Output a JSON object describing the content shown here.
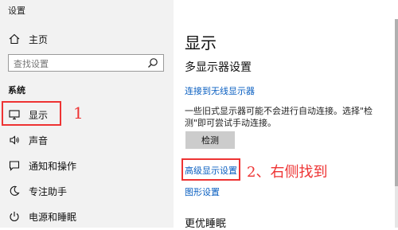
{
  "window": {
    "title": "设置",
    "minimize_glyph": "—",
    "maximize_glyph": "☐",
    "close_glyph": "✕"
  },
  "sidebar": {
    "home_label": "主页",
    "search_placeholder": "查找设置",
    "section_label": "系统",
    "items": [
      {
        "label": "显示",
        "icon": "monitor-icon"
      },
      {
        "label": "声音",
        "icon": "speaker-icon"
      },
      {
        "label": "通知和操作",
        "icon": "notification-icon"
      },
      {
        "label": "专注助手",
        "icon": "moon-icon"
      },
      {
        "label": "电源和睡眠",
        "icon": "power-icon"
      }
    ]
  },
  "main": {
    "page_title": "显示",
    "section_title": "多显示器设置",
    "wireless_link": "连接到无线显示器",
    "description": "一些旧式显示器可能不会进行自动连接。选择\"检测\"即可尝试手动连接。",
    "detect_button": "检测",
    "advanced_link": "高级显示设置",
    "graphics_link": "图形设置",
    "next_section": "更优睡眠"
  },
  "annotations": {
    "step1": "1",
    "step2": "2、右侧找到"
  },
  "colors": {
    "accent_link": "#0a5fc1",
    "annotation_red": "#e33333",
    "sidebar_bg": "#f2f2f2"
  }
}
